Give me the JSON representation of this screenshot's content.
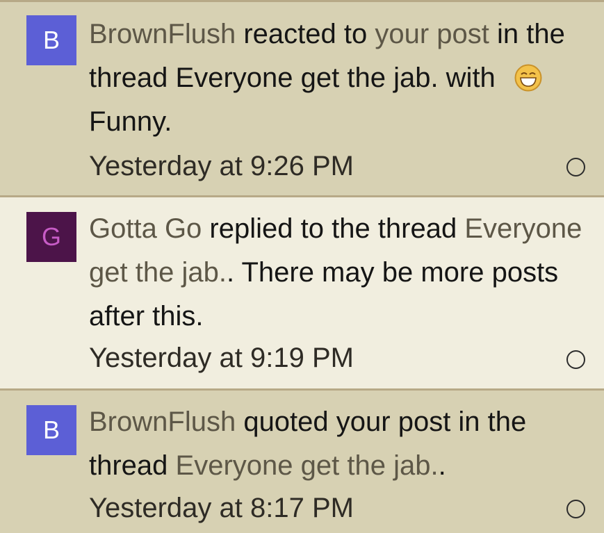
{
  "alerts": [
    {
      "avatar_letter": "B",
      "avatar_bg": "#5c5fd6",
      "avatar_fg": "#ffffff",
      "user": "BrownFlush",
      "action": " reacted to ",
      "post_link": "your post",
      "mid": " in the thread Everyone get the jab. with ",
      "reaction": "Funny.",
      "reaction_icon": "laughing-face-icon",
      "time": "Yesterday at 9:26 PM",
      "state": "read"
    },
    {
      "avatar_letter": "G",
      "avatar_bg": "#4c1449",
      "avatar_fg": "#c75cc6",
      "user": "Gotta Go",
      "action": " replied to the thread ",
      "thread_link": "Everyone get the jab.",
      "tail": ". There may be more posts after this.",
      "time": "Yesterday at 9:19 PM",
      "state": "unread"
    },
    {
      "avatar_letter": "B",
      "avatar_bg": "#5c5fd6",
      "avatar_fg": "#ffffff",
      "user": "BrownFlush",
      "action": " quoted your post in the thread ",
      "thread_link": "Everyone get the jab.",
      "tail": ".",
      "time": "Yesterday at 8:17 PM",
      "state": "read"
    }
  ]
}
